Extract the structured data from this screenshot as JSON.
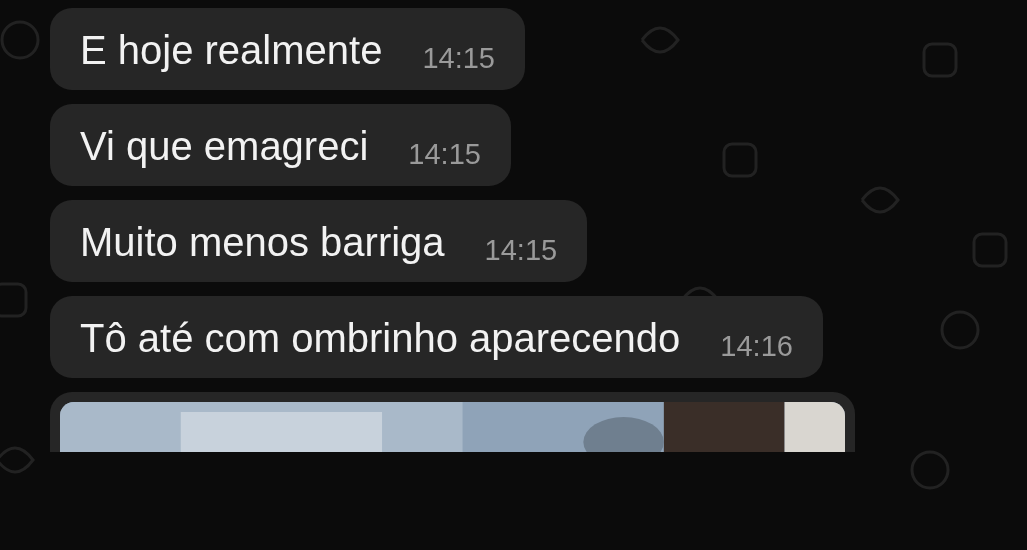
{
  "messages": [
    {
      "text": "E hoje realmente",
      "time": "14:15"
    },
    {
      "text": "Vi que emagreci",
      "time": "14:15"
    },
    {
      "text": "Muito menos barriga",
      "time": "14:15"
    },
    {
      "text": "Tô até com ombrinho aparecendo",
      "time": "14:16"
    }
  ]
}
